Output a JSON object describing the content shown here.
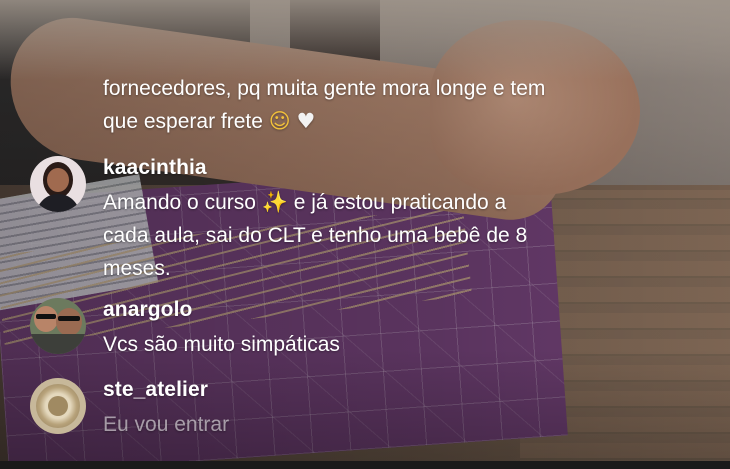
{
  "comments": [
    {
      "username": "",
      "lines": [
        "fornecedores, pq muita gente mora longe e tem",
        "que esperar frete"
      ],
      "emojis": [
        "☺",
        "♥"
      ],
      "faded": false
    },
    {
      "username": "kaacinthia",
      "text_before": "Amando o curso",
      "sparkle": "✨",
      "text_after": " e já estou praticando a",
      "lines": [
        "cada aula, sai do CLT e tenho uma bebê de 8",
        "meses."
      ],
      "faded": false
    },
    {
      "username": "anargolo",
      "lines": [
        "Vcs são muito simpáticas"
      ],
      "faded": false
    },
    {
      "username": "ste_atelier",
      "lines": [
        "Eu vou entrar"
      ],
      "faded": true
    }
  ],
  "colors": {
    "text": "#ffffff",
    "mat": "#6e3f73",
    "table": "#6d5a4b"
  },
  "icons": {
    "smile": "smiling-face-emoji",
    "heart": "white-heart-emoji",
    "sparkle": "sparkles-emoji"
  }
}
